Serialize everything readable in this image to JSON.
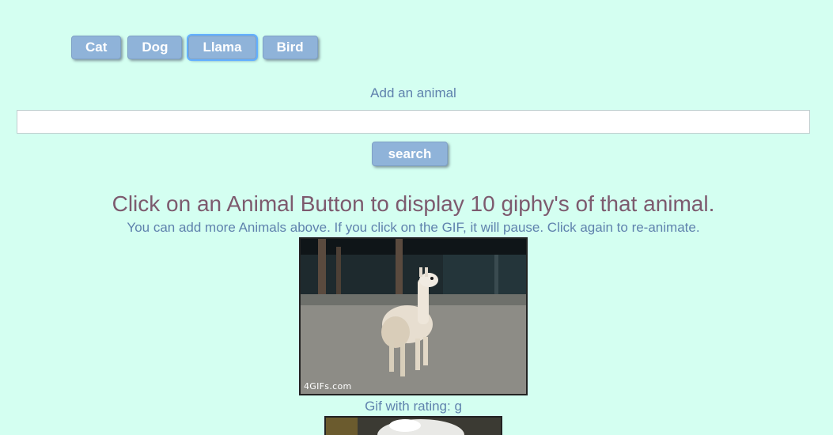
{
  "animal_buttons": [
    {
      "label": "Cat"
    },
    {
      "label": "Dog"
    },
    {
      "label": "Llama"
    },
    {
      "label": "Bird"
    }
  ],
  "add_form": {
    "label": "Add an animal",
    "input_value": "",
    "search_label": "search"
  },
  "instructions": {
    "headline": "Click on an Animal Button to display 10 giphy's of that animal.",
    "subline": "You can add more Animals above. If you click on the GIF, it will pause. Click again to re-animate."
  },
  "results": [
    {
      "watermark": "4GIFs.com",
      "rating_text": "Gif with rating: g"
    }
  ],
  "colors": {
    "background": "#d4fff1",
    "button": "#8fb3d9",
    "headline": "#7d5a6e",
    "subtext": "#5f82ad"
  }
}
